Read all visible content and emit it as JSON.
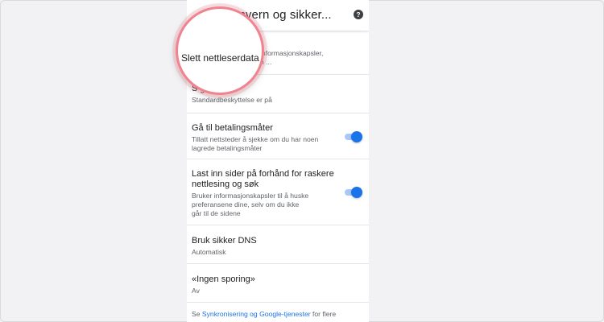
{
  "header": {
    "title": "envern og sikker...",
    "help_icon": "help-circle-icon"
  },
  "magnifier": {
    "label": "Slett nettleserdata"
  },
  "rows": [
    {
      "title": "",
      "subtitle_1": "informasjonskapsler,",
      "subtitle_2": "n ..."
    },
    {
      "title": "S g",
      "subtitle_1": "Standardbeskyttelse er på"
    },
    {
      "title": "Gå til betalingsmåter",
      "subtitle_1": "Tillatt nettsteder å sjekke om du har noen",
      "subtitle_2": "lagrede betalingsmåter",
      "toggle_on": true
    },
    {
      "title_1": "Last inn sider på forhånd for raskere",
      "title_2": "nettlesing og søk",
      "subtitle_1": "Bruker informasjonskapsler til å huske",
      "subtitle_2": "preferansene dine, selv om du ikke",
      "subtitle_3": "går til de sidene",
      "toggle_on": true
    },
    {
      "title": "Bruk sikker DNS",
      "subtitle_1": "Automatisk"
    },
    {
      "title": "«Ingen sporing»",
      "subtitle_1": "Av"
    }
  ],
  "footer": {
    "prefix": "Se ",
    "link": "Synkronisering og Google-tjenester",
    "suffix": " for flere"
  },
  "colors": {
    "accent": "#1a73e8",
    "toggle_track": "#a8c7fa",
    "magnifier_ring": "#f0838f"
  }
}
